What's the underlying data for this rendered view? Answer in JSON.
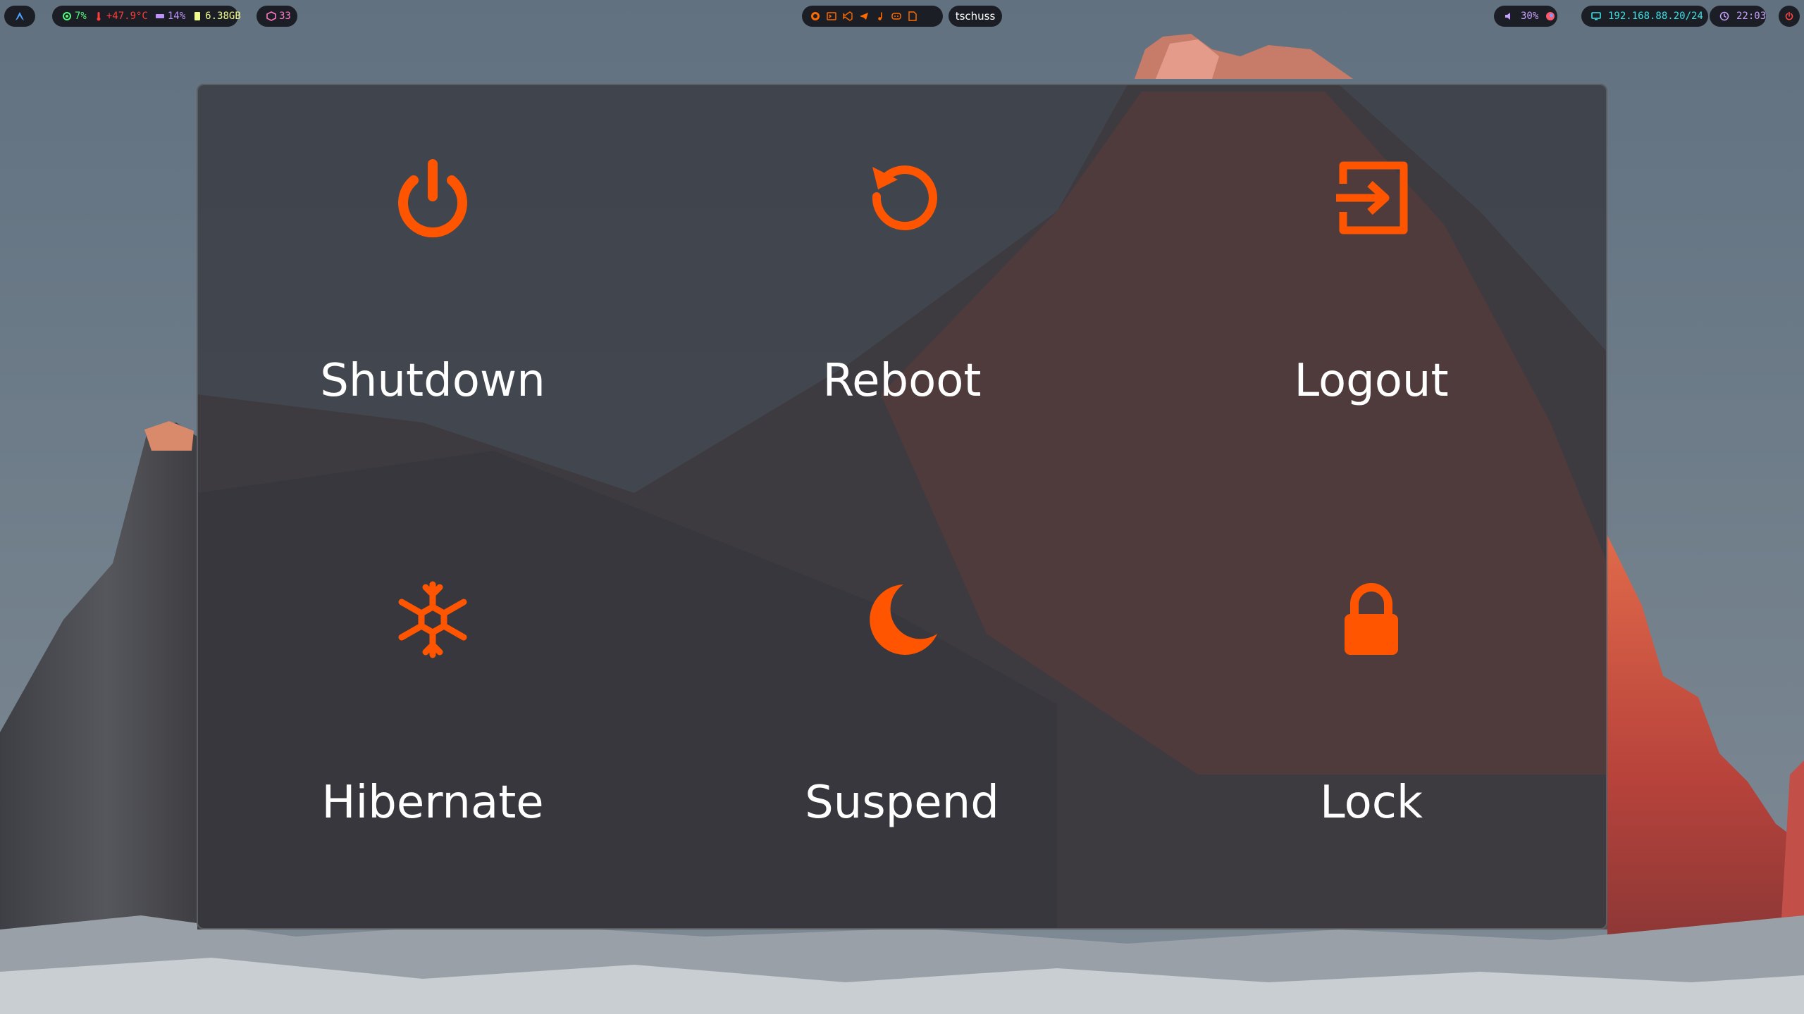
{
  "colors": {
    "accent": "#ff5500",
    "bar_background": "#1b1e24",
    "panel_background": "#34363c",
    "label_text": "#ffffff",
    "cpu": "#50fa7b",
    "temperature": "#ff3b3b",
    "memory": "#bd93f9",
    "disk": "#f1fa8c",
    "updates": "#ff79c6",
    "network": "#3ce0e6",
    "clock": "#c8a0ff",
    "power": "#ff4444"
  },
  "topbar": {
    "launcher_icon": "arch-logo-icon",
    "stats": {
      "cpu": "7%",
      "temperature": "+47.9°C",
      "memory": "14%",
      "disk": "6.38GB"
    },
    "updates": {
      "icon": "package-icon",
      "count": "33"
    },
    "apps": [
      {
        "name": "firefox-icon"
      },
      {
        "name": "terminal-icon"
      },
      {
        "name": "vscode-icon"
      },
      {
        "name": "telegram-icon"
      },
      {
        "name": "music-icon"
      },
      {
        "name": "discord-icon"
      },
      {
        "name": "files-icon"
      }
    ],
    "active_window_title": "tschuss",
    "volume": {
      "icon": "speaker-icon",
      "level": "30%"
    },
    "network": {
      "icon": "monitor-icon",
      "address": "192.168.88.20/24"
    },
    "clock": {
      "icon": "clock-icon",
      "time": "22:03"
    },
    "power_icon": "power-icon"
  },
  "logout_menu": {
    "options": [
      {
        "label": "Shutdown",
        "icon": "power-icon"
      },
      {
        "label": "Reboot",
        "icon": "reboot-icon"
      },
      {
        "label": "Logout",
        "icon": "logout-icon"
      },
      {
        "label": "Hibernate",
        "icon": "snowflake-icon"
      },
      {
        "label": "Suspend",
        "icon": "moon-icon"
      },
      {
        "label": "Lock",
        "icon": "lock-icon"
      }
    ]
  }
}
